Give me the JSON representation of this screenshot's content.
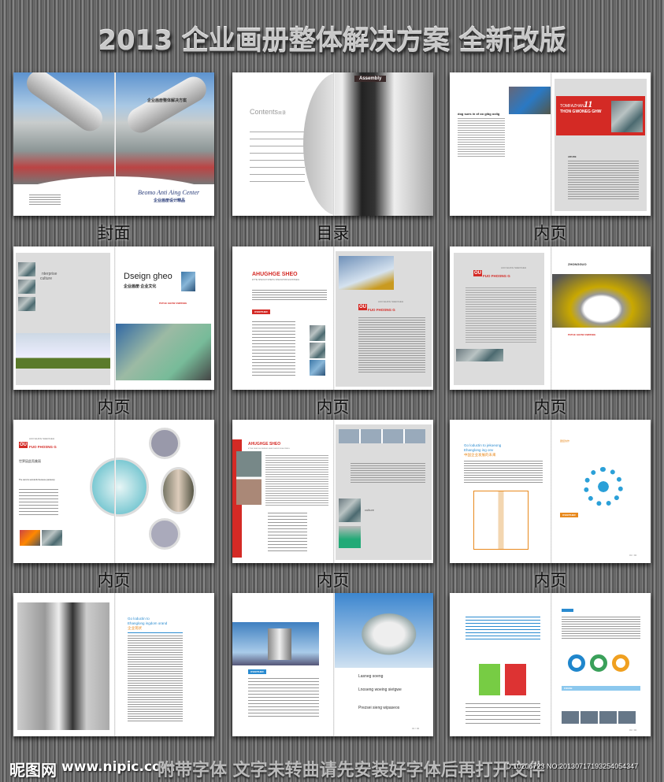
{
  "header": {
    "title": "2013 企业画册整体解决方案  全新改版"
  },
  "footer": {
    "watermark_logo": "昵图网",
    "site": "www.nipic.com",
    "notice": "附带字体 文字未转曲请先安装好字体后再打开文件",
    "id_text": "ID:10206723 NO:20130717193254054347"
  },
  "spreads": [
    {
      "label": "封面",
      "cover_title_cn": "企业画册整体解决方案",
      "brand_en": "Beomo Anti Aing Center",
      "brand_cn": "企业画册设计精品"
    },
    {
      "label": "目录",
      "contents_en": "Contents",
      "contents_cn": "目录",
      "photo_tag": "Assembly"
    },
    {
      "label": "内页",
      "heading": "dog sues in of oo gibg oolig",
      "red_title_1": "TOMFAZHAN",
      "red_num": "11",
      "red_title_2": "THON GWONEG GHW",
      "sub": "ARUDE"
    },
    {
      "label": "内页",
      "enterprise": "nterprise",
      "culture": "culture",
      "design": "Dseign gheo",
      "design_cn": "企业画册 企业文化",
      "tag": "PATGE GHOW GWRDBG"
    },
    {
      "label": "内页",
      "heading": "AHUGHGE SHEO",
      "heading_sub": "E'THE SHEOGH SHIEHG SHEOGHOW EIGHOWEIG",
      "badge": "OVERTHER",
      "right_small": "AUO EHOG SHEOGEH",
      "right_title": "FUO FHOSNG G",
      "ou": "OU"
    },
    {
      "label": "内页",
      "small": "AUO EHOG SHEOGEH",
      "title": "FUO FHOSNG G",
      "ou": "OU",
      "right_title": "ZHONGGUO",
      "tag": "PATGE GHOW GWRDBG"
    },
    {
      "label": "内页",
      "small": "AUO EHOG SHEOGEH",
      "title": "FUO FHOSNG G",
      "ou": "OU",
      "cn": "世界因此而美丽",
      "en": "The word is wonderful because passively"
    },
    {
      "label": "内页",
      "heading": "AHUGHGE SHEO",
      "heading_sub": "E'THE SHEOGH SHIEHG SHEOGHOW EIGHOWEIG",
      "culture": "culture"
    },
    {
      "label": "内页",
      "heading_1": "Go loductin to jekoeong",
      "heading_2": "Ehanglong ing onv",
      "heading_cn": "中国企业发展的未来",
      "right_cn": "团结协作",
      "right_badge": "OVERTHER",
      "page_no": "01 / 02"
    },
    {
      "label": "",
      "heading_1": "Go loductin to",
      "heading_2": "Ehanglong ingdom orand",
      "heading_cn": "企业现状"
    },
    {
      "label": "",
      "badge": "OVERTHER",
      "h1": "Lasneg soeng",
      "h2": "Lnoseng woeing sietgwe",
      "h3": "Prezsei sieng wipaseos",
      "page_no": "01 / 02"
    },
    {
      "label": "",
      "badge": "FOUDE",
      "page_no": "01 / 02"
    }
  ]
}
